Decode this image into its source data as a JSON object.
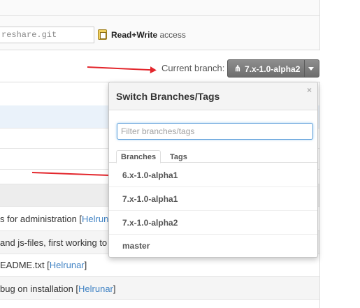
{
  "clone": {
    "url_value": "reshare.git",
    "access_strong": "Read+Write",
    "access_suffix": " access"
  },
  "branch_bar": {
    "label": "Current branch:",
    "fork_glyph": "⋔",
    "current": "7.x-1.0-alpha2"
  },
  "dropdown": {
    "title": "Switch Branches/Tags",
    "close": "×",
    "filter_placeholder": "Filter branches/tags",
    "tabs": [
      {
        "label": "Branches",
        "active": true
      },
      {
        "label": "Tags",
        "active": false
      }
    ],
    "items": [
      {
        "label": "6.x-1.0-alpha1"
      },
      {
        "label": "7.x-1.0-alpha1"
      },
      {
        "label": "7.x-1.0-alpha2"
      },
      {
        "label": "master"
      }
    ]
  },
  "commits": [
    {
      "message": "s for administration [",
      "author": "Helrunar"
    },
    {
      "message": "and js-files, first working to",
      "author": ""
    },
    {
      "message": "EADME.txt [",
      "author": "Helrunar",
      "suffix": "]"
    },
    {
      "message": " bug on installation [",
      "author": "Helrunar",
      "suffix": "]"
    }
  ],
  "colors": {
    "arrow": "#e3262c",
    "link": "#4183c4",
    "button": "#7a7a7a",
    "filter_focus": "#5b9dd9"
  }
}
